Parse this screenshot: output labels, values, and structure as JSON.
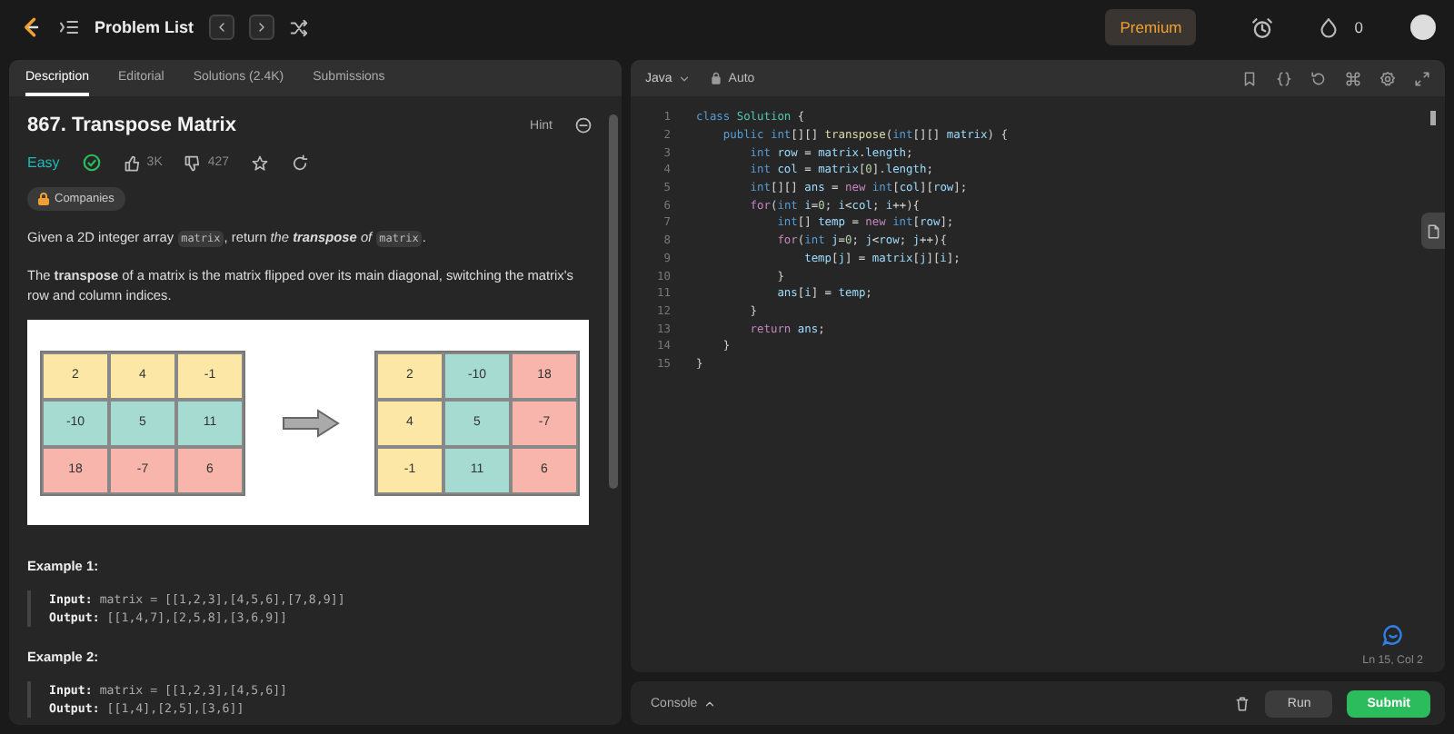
{
  "topbar": {
    "title": "Problem List",
    "premium": "Premium",
    "streak": "0"
  },
  "tabs": [
    {
      "label": "Description",
      "selected": true
    },
    {
      "label": "Editorial",
      "selected": false
    },
    {
      "label": "Solutions (2.4K)",
      "selected": false
    },
    {
      "label": "Submissions",
      "selected": false
    }
  ],
  "problem": {
    "title": "867. Transpose Matrix",
    "hint": "Hint",
    "difficulty": "Easy",
    "solved": true,
    "likes": "3K",
    "dislikes": "427",
    "companies": "Companies",
    "paragraphs": [
      [
        {
          "kind": "text",
          "text": "Given a 2D integer array "
        },
        {
          "kind": "code",
          "text": "matrix"
        },
        {
          "kind": "text",
          "text": ", return "
        },
        {
          "kind": "em",
          "text": "the **transpose** of "
        },
        {
          "kind": "code",
          "text": "matrix"
        },
        {
          "kind": "text",
          "text": "."
        }
      ],
      [
        {
          "kind": "text",
          "text": "The **transpose** of a matrix is the matrix flipped over its main diagonal, switching the matrix's row and column indices."
        }
      ]
    ],
    "figure": {
      "before": [
        [
          {
            "text": "2",
            "color": "#fde7a6"
          },
          {
            "text": "4",
            "color": "#fde7a6"
          },
          {
            "text": "-1",
            "color": "#fde7a6"
          }
        ],
        [
          {
            "text": "-10",
            "color": "#a6dbd2"
          },
          {
            "text": "5",
            "color": "#a6dbd2"
          },
          {
            "text": "11",
            "color": "#a6dbd2"
          }
        ],
        [
          {
            "text": "18",
            "color": "#f7b5ac"
          },
          {
            "text": "-7",
            "color": "#f7b5ac"
          },
          {
            "text": "6",
            "color": "#f7b5ac"
          }
        ]
      ],
      "after": [
        [
          {
            "text": "2",
            "color": "#fde7a6"
          },
          {
            "text": "-10",
            "color": "#a6dbd2"
          },
          {
            "text": "18",
            "color": "#f7b5ac"
          }
        ],
        [
          {
            "text": "4",
            "color": "#fde7a6"
          },
          {
            "text": "5",
            "color": "#a6dbd2"
          },
          {
            "text": "-7",
            "color": "#f7b5ac"
          }
        ],
        [
          {
            "text": "-1",
            "color": "#fde7a6"
          },
          {
            "text": "11",
            "color": "#a6dbd2"
          },
          {
            "text": "6",
            "color": "#f7b5ac"
          }
        ]
      ]
    },
    "examples": [
      {
        "title": "Example 1:",
        "lines": [
          {
            "label": "Input:",
            "value": "matrix = [[1,2,3],[4,5,6],[7,8,9]]"
          },
          {
            "label": "Output:",
            "value": "[[1,4,7],[2,5,8],[3,6,9]]"
          }
        ]
      },
      {
        "title": "Example 2:",
        "lines": [
          {
            "label": "Input:",
            "value": "matrix = [[1,2,3],[4,5,6]]"
          },
          {
            "label": "Output:",
            "value": "[[1,4],[2,5],[3,6]]"
          }
        ]
      }
    ]
  },
  "editor": {
    "language": "Java",
    "mode": "Auto",
    "status": "Ln 15, Col 2",
    "lines": [
      {
        "number": "1",
        "tokens": [
          {
            "kind": "kw",
            "text": "class "
          },
          {
            "kind": "type",
            "text": "Solution"
          },
          {
            "kind": "p",
            "text": " {"
          }
        ]
      },
      {
        "number": "2",
        "tokens": [
          {
            "kind": "kw",
            "text": "    public int"
          },
          {
            "kind": "p",
            "text": "[][] "
          },
          {
            "kind": "fn",
            "text": "transpose"
          },
          {
            "kind": "p",
            "text": "("
          },
          {
            "kind": "kw",
            "text": "int"
          },
          {
            "kind": "p",
            "text": "[][] "
          },
          {
            "kind": "id",
            "text": "matrix"
          },
          {
            "kind": "p",
            "text": ") {"
          }
        ]
      },
      {
        "number": "3",
        "tokens": [
          {
            "kind": "kw",
            "text": "        int "
          },
          {
            "kind": "id",
            "text": "row"
          },
          {
            "kind": "p",
            "text": " = "
          },
          {
            "kind": "id",
            "text": "matrix"
          },
          {
            "kind": "p",
            "text": "."
          },
          {
            "kind": "id",
            "text": "length"
          },
          {
            "kind": "p",
            "text": ";"
          }
        ]
      },
      {
        "number": "4",
        "tokens": [
          {
            "kind": "kw",
            "text": "        int "
          },
          {
            "kind": "id",
            "text": "col"
          },
          {
            "kind": "p",
            "text": " = "
          },
          {
            "kind": "id",
            "text": "matrix"
          },
          {
            "kind": "p",
            "text": "["
          },
          {
            "kind": "num",
            "text": "0"
          },
          {
            "kind": "p",
            "text": "]."
          },
          {
            "kind": "id",
            "text": "length"
          },
          {
            "kind": "p",
            "text": ";"
          }
        ]
      },
      {
        "number": "5",
        "tokens": [
          {
            "kind": "kw",
            "text": "        int"
          },
          {
            "kind": "p",
            "text": "[][] "
          },
          {
            "kind": "id",
            "text": "ans"
          },
          {
            "kind": "p",
            "text": " = "
          },
          {
            "kind": "ctrl",
            "text": "new "
          },
          {
            "kind": "kw",
            "text": "int"
          },
          {
            "kind": "p",
            "text": "["
          },
          {
            "kind": "id",
            "text": "col"
          },
          {
            "kind": "p",
            "text": "]["
          },
          {
            "kind": "id",
            "text": "row"
          },
          {
            "kind": "p",
            "text": "];"
          }
        ]
      },
      {
        "number": "6",
        "tokens": [
          {
            "kind": "ctrl",
            "text": "        for"
          },
          {
            "kind": "p",
            "text": "("
          },
          {
            "kind": "kw",
            "text": "int "
          },
          {
            "kind": "id",
            "text": "i"
          },
          {
            "kind": "p",
            "text": "="
          },
          {
            "kind": "num",
            "text": "0"
          },
          {
            "kind": "p",
            "text": "; "
          },
          {
            "kind": "id",
            "text": "i"
          },
          {
            "kind": "p",
            "text": "<"
          },
          {
            "kind": "id",
            "text": "col"
          },
          {
            "kind": "p",
            "text": "; "
          },
          {
            "kind": "id",
            "text": "i"
          },
          {
            "kind": "p",
            "text": "++){"
          }
        ]
      },
      {
        "number": "7",
        "tokens": [
          {
            "kind": "kw",
            "text": "            int"
          },
          {
            "kind": "p",
            "text": "[] "
          },
          {
            "kind": "id",
            "text": "temp"
          },
          {
            "kind": "p",
            "text": " = "
          },
          {
            "kind": "ctrl",
            "text": "new "
          },
          {
            "kind": "kw",
            "text": "int"
          },
          {
            "kind": "p",
            "text": "["
          },
          {
            "kind": "id",
            "text": "row"
          },
          {
            "kind": "p",
            "text": "];"
          }
        ]
      },
      {
        "number": "8",
        "tokens": [
          {
            "kind": "ctrl",
            "text": "            for"
          },
          {
            "kind": "p",
            "text": "("
          },
          {
            "kind": "kw",
            "text": "int "
          },
          {
            "kind": "id",
            "text": "j"
          },
          {
            "kind": "p",
            "text": "="
          },
          {
            "kind": "num",
            "text": "0"
          },
          {
            "kind": "p",
            "text": "; "
          },
          {
            "kind": "id",
            "text": "j"
          },
          {
            "kind": "p",
            "text": "<"
          },
          {
            "kind": "id",
            "text": "row"
          },
          {
            "kind": "p",
            "text": "; "
          },
          {
            "kind": "id",
            "text": "j"
          },
          {
            "kind": "p",
            "text": "++){"
          }
        ]
      },
      {
        "number": "9",
        "tokens": [
          {
            "kind": "id",
            "text": "                temp"
          },
          {
            "kind": "p",
            "text": "["
          },
          {
            "kind": "id",
            "text": "j"
          },
          {
            "kind": "p",
            "text": "] = "
          },
          {
            "kind": "id",
            "text": "matrix"
          },
          {
            "kind": "p",
            "text": "["
          },
          {
            "kind": "id",
            "text": "j"
          },
          {
            "kind": "p",
            "text": "]["
          },
          {
            "kind": "id",
            "text": "i"
          },
          {
            "kind": "p",
            "text": "];"
          }
        ]
      },
      {
        "number": "10",
        "tokens": [
          {
            "kind": "p",
            "text": "            }"
          }
        ]
      },
      {
        "number": "11",
        "tokens": [
          {
            "kind": "id",
            "text": "            ans"
          },
          {
            "kind": "p",
            "text": "["
          },
          {
            "kind": "id",
            "text": "i"
          },
          {
            "kind": "p",
            "text": "] = "
          },
          {
            "kind": "id",
            "text": "temp"
          },
          {
            "kind": "p",
            "text": ";"
          }
        ]
      },
      {
        "number": "12",
        "tokens": [
          {
            "kind": "p",
            "text": "        }"
          }
        ]
      },
      {
        "number": "13",
        "tokens": [
          {
            "kind": "ctrl",
            "text": "        return "
          },
          {
            "kind": "id",
            "text": "ans"
          },
          {
            "kind": "p",
            "text": ";"
          }
        ]
      },
      {
        "number": "14",
        "tokens": [
          {
            "kind": "p",
            "text": "    }"
          }
        ]
      },
      {
        "number": "15",
        "tokens": [
          {
            "kind": "p",
            "text": "}"
          }
        ]
      }
    ]
  },
  "console": {
    "label": "Console",
    "run": "Run",
    "submit": "Submit"
  }
}
